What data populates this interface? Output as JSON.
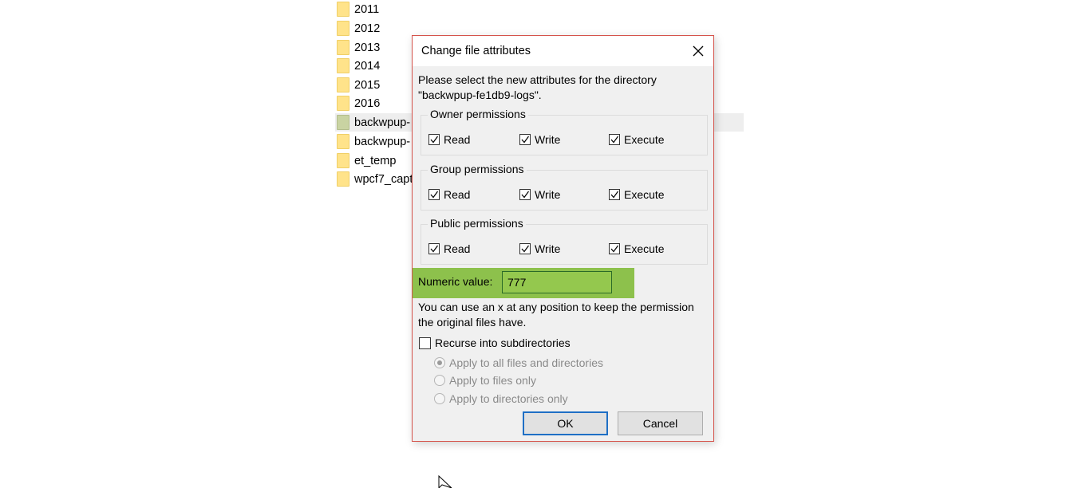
{
  "file_list": [
    {
      "name": "2011"
    },
    {
      "name": "2012"
    },
    {
      "name": "2013"
    },
    {
      "name": "2014"
    },
    {
      "name": "2015"
    },
    {
      "name": "2016"
    },
    {
      "name": "backwpup-",
      "selected": true
    },
    {
      "name": "backwpup-"
    },
    {
      "name": "et_temp"
    },
    {
      "name": "wpcf7_capt"
    }
  ],
  "dialog": {
    "title": "Change file attributes",
    "description_line1": "Please select the new attributes for the directory",
    "description_line2": "\"backwpup-fe1db9-logs\".",
    "groups": [
      {
        "label": "Owner permissions",
        "read": "Read",
        "write": "Write",
        "execute": "Execute"
      },
      {
        "label": "Group permissions",
        "read": "Read",
        "write": "Write",
        "execute": "Execute"
      },
      {
        "label": "Public permissions",
        "read": "Read",
        "write": "Write",
        "execute": "Execute"
      }
    ],
    "numeric_label": "Numeric value:",
    "numeric_value": "777",
    "hint_line1": "You can use an x at any position to keep the permission",
    "hint_line2": "the original files have.",
    "recurse_label": "Recurse into subdirectories",
    "radio_all": "Apply to all files and directories",
    "radio_files": "Apply to files only",
    "radio_dirs": "Apply to directories only",
    "ok_label": "OK",
    "cancel_label": "Cancel"
  },
  "colors": {
    "highlight": "#8dc14c",
    "dialog_border": "#d5534b",
    "ok_border": "#1f6fc5"
  }
}
